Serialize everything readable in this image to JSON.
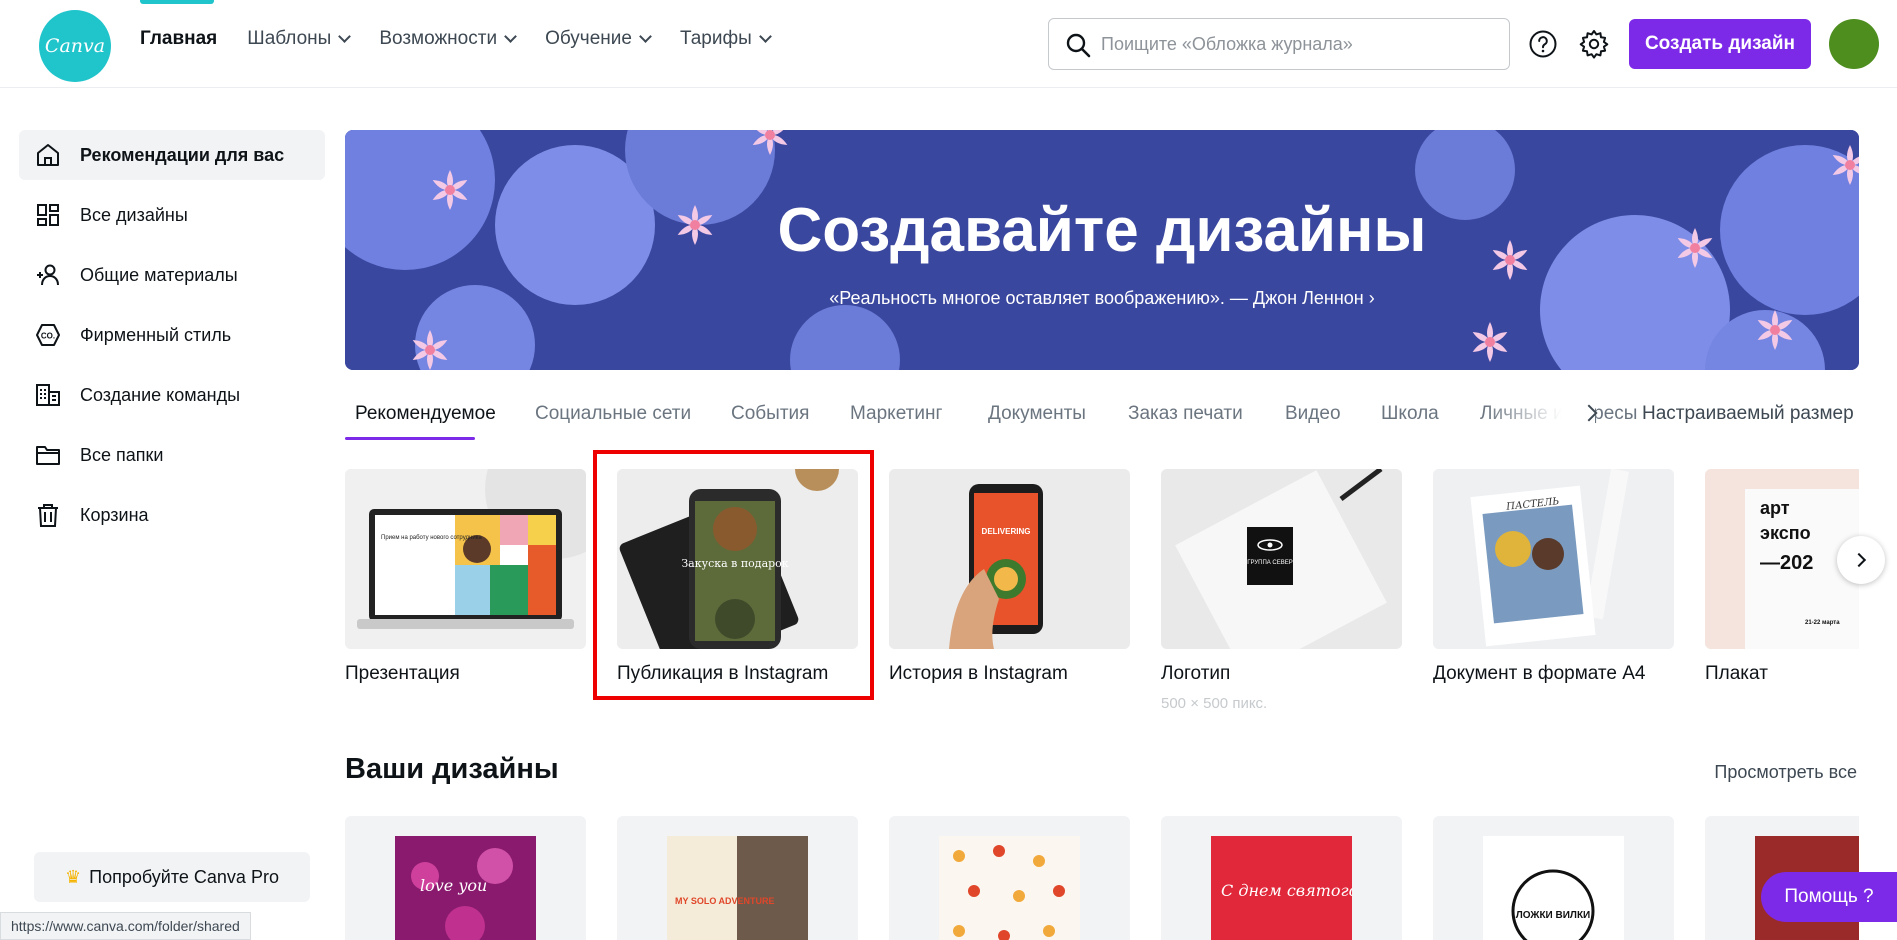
{
  "header": {
    "logo_text": "Canva",
    "nav": [
      {
        "label": "Главная",
        "active": true,
        "dropdown": false
      },
      {
        "label": "Шаблоны",
        "active": false,
        "dropdown": true
      },
      {
        "label": "Возможности",
        "active": false,
        "dropdown": true
      },
      {
        "label": "Обучение",
        "active": false,
        "dropdown": true
      },
      {
        "label": "Тарифы",
        "active": false,
        "dropdown": true
      }
    ],
    "search_placeholder": "Поищите «Обложка журнала»",
    "create_button": "Создать дизайн",
    "help_icon": "question-circle-icon",
    "settings_icon": "gear-icon"
  },
  "sidebar": {
    "items": [
      {
        "label": "Рекомендации для вас",
        "icon": "home-icon",
        "active": true
      },
      {
        "label": "Все дизайны",
        "icon": "grid-icon",
        "active": false
      },
      {
        "label": "Общие материалы",
        "icon": "people-icon",
        "active": false
      },
      {
        "label": "Фирменный стиль",
        "icon": "brand-kit-icon",
        "active": false
      },
      {
        "label": "Создание команды",
        "icon": "team-icon",
        "active": false
      },
      {
        "label": "Все папки",
        "icon": "folder-icon",
        "active": false
      },
      {
        "label": "Корзина",
        "icon": "trash-icon",
        "active": false
      }
    ],
    "pro_button": "Попробуйте Canva Pro"
  },
  "hero": {
    "title": "Создавайте дизайны",
    "subtitle": "«Реальность многое оставляет воображению». — Джон Леннон ›"
  },
  "tabs": {
    "items": [
      "Рекомендуемое",
      "Социальные сети",
      "События",
      "Маркетинг",
      "Документы",
      "Заказ печати",
      "Видео",
      "Школа",
      "Личные интересы"
    ],
    "custom_size": "Настраиваемый размер"
  },
  "templates": [
    {
      "label": "Презентация",
      "meta": ""
    },
    {
      "label": "Публикация в Instagram",
      "meta": ""
    },
    {
      "label": "История в Instagram",
      "meta": ""
    },
    {
      "label": "Логотип",
      "meta": "500 × 500 пикс."
    },
    {
      "label": "Документ в формате A4",
      "meta": ""
    },
    {
      "label": "Плакат",
      "meta": ""
    }
  ],
  "thumb_text": {
    "presentation": "Прием на работу нового сотрудника",
    "instagram_post": "Закуска в подарок",
    "instagram_story": "DELIVERING",
    "logo": "ГРУППА СЕВЕР",
    "a4_doc": "ПАСТЕЛЬ",
    "poster_line1": "арт",
    "poster_line2": "экспо",
    "poster_line3": "—202",
    "poster_date": "21-22 марта"
  },
  "your_designs": {
    "title": "Ваши дизайны",
    "see_all": "Просмотреть все",
    "cards": [
      {
        "text": "love you"
      },
      {
        "text": "MY SOLO ADVENTURE"
      },
      {
        "text": ""
      },
      {
        "text": "С днем святого Валентина"
      },
      {
        "text": "ЛОЖКИ ВИЛКИ"
      },
      {
        "text": ""
      }
    ]
  },
  "status_url": "https://www.canva.com/folder/shared",
  "help_button": "Помощь  ?",
  "colors": {
    "accent": "#7d2ae8",
    "logo": "#20c4cb",
    "hero": "#3d4ca6",
    "highlight": "#ee0000"
  }
}
